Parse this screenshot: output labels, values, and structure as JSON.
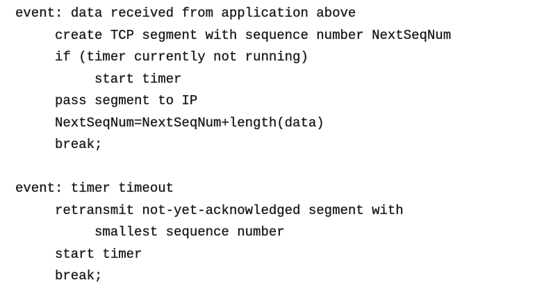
{
  "sections": [
    {
      "lines": [
        {
          "text": "event: data received from application above",
          "indent": 0
        },
        {
          "text": "create TCP segment with sequence number NextSeqNum",
          "indent": 1
        },
        {
          "text": "if (timer currently not running)",
          "indent": 1
        },
        {
          "text": "start timer",
          "indent": 2
        },
        {
          "text": "pass segment to IP",
          "indent": 1
        },
        {
          "text": "NextSeqNum=NextSeqNum+length(data)",
          "indent": 1
        },
        {
          "text": "break;",
          "indent": 1
        }
      ]
    },
    {
      "lines": [
        {
          "text": "event: timer timeout",
          "indent": 0
        },
        {
          "text": "retransmit not-yet-acknowledged segment with",
          "indent": 1
        },
        {
          "text": "smallest sequence number",
          "indent": 2
        },
        {
          "text": "start timer",
          "indent": 1
        },
        {
          "text": "break;",
          "indent": 1
        }
      ]
    }
  ]
}
